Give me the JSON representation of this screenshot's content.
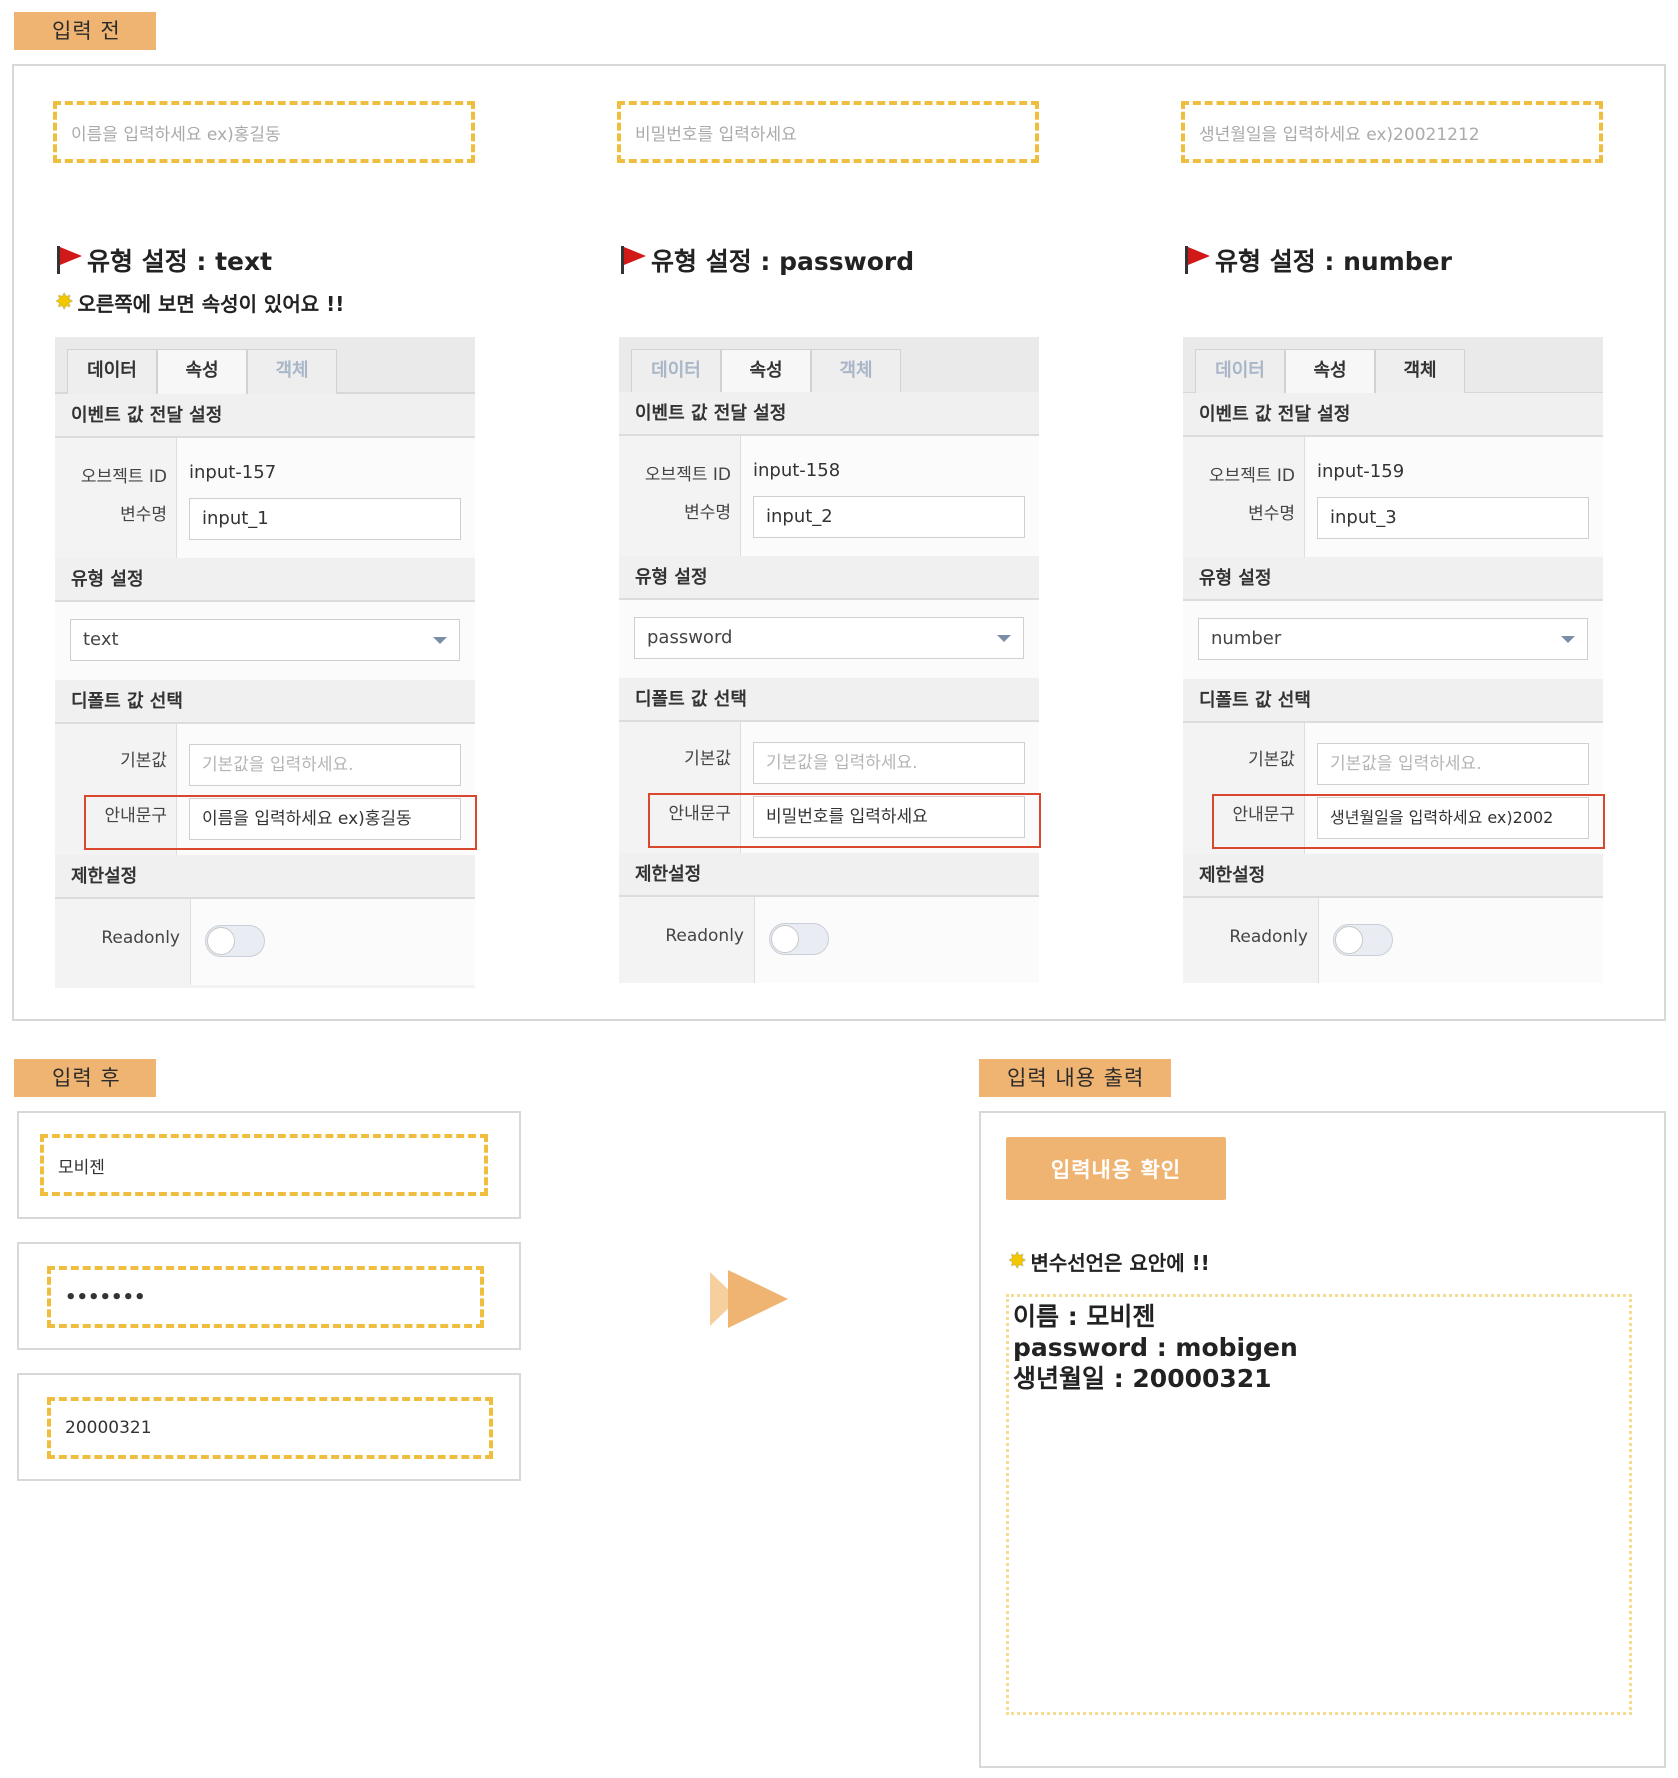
{
  "sections": {
    "before": "입력 전",
    "after": "입력 후",
    "output": "입력 내용 출력"
  },
  "columns": [
    {
      "placeholder": "이름을 입력하세요 ex)홍길동",
      "title": "유형 설정 : text",
      "note": "오른쪽에 보면 속성이 있어요 !!",
      "object_id": "input-157",
      "variable": "input_1",
      "type_value": "text",
      "guide_text": "이름을 입력하세요 ex)홍길동"
    },
    {
      "placeholder": "비밀번호를 입력하세요",
      "title": "유형 설정 : password",
      "object_id": "input-158",
      "variable": "input_2",
      "type_value": "password",
      "guide_text": "비밀번호를 입력하세요"
    },
    {
      "placeholder": "생년월일을 입력하세요 ex)20021212",
      "title": "유형 설정 : number",
      "object_id": "input-159",
      "variable": "input_3",
      "type_value": "number",
      "guide_text": "생년월일을 입력하세요 ex)2002"
    }
  ],
  "panel": {
    "tabs": [
      "데이터",
      "속성",
      "객체"
    ],
    "event_header": "이벤트 값 전달 설정",
    "object_id_label": "오브젝트 ID",
    "variable_label": "변수명",
    "type_header": "유형 설정",
    "default_header": "디폴트 값 선택",
    "default_label": "기본값",
    "default_placeholder": "기본값을 입력하세요.",
    "guide_label": "안내문구",
    "limit_header": "제한설정",
    "readonly_label": "Readonly"
  },
  "after_inputs": {
    "name": "모비젠",
    "password": "•••••••",
    "birth": "20000321"
  },
  "output": {
    "button": "입력내용 확인",
    "note": "변수선언은 요안에 !!",
    "lines": [
      "이름 : 모비젠",
      "password : mobigen",
      "생년월일 : 20000321"
    ]
  },
  "colors": {
    "tag": "#efb472",
    "dashed_border": "#f0be3e",
    "highlight_box": "#d9472e",
    "output_border": "#f6dc8e"
  }
}
